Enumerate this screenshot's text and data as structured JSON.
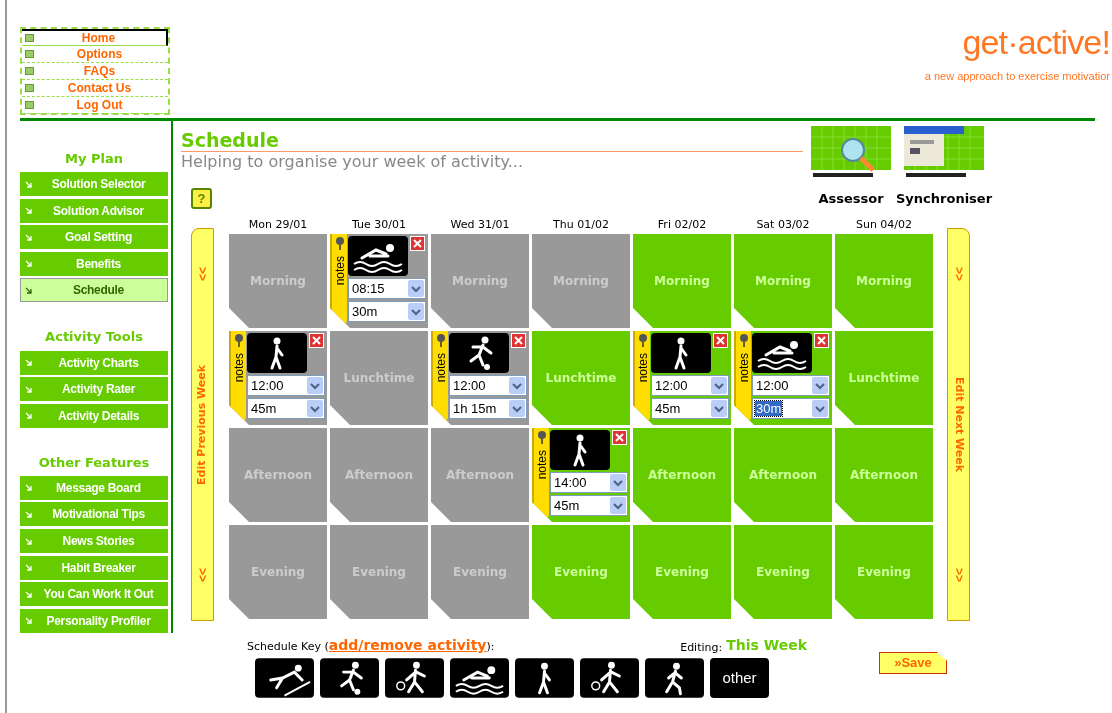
{
  "top_nav": [
    {
      "label": "Home",
      "selected": true
    },
    {
      "label": "Options",
      "selected": false
    },
    {
      "label": "FAQs",
      "selected": false
    },
    {
      "label": "Contact Us",
      "selected": false
    },
    {
      "label": "Log Out",
      "selected": false
    }
  ],
  "logo": {
    "name": "get·active!",
    "tagline": "a new approach to exercise motivatior"
  },
  "sidebar": [
    {
      "heading": "My Plan",
      "items": [
        {
          "label": "Solution Selector",
          "selected": false
        },
        {
          "label": "Solution Advisor",
          "selected": false
        },
        {
          "label": "Goal Setting",
          "selected": false
        },
        {
          "label": "Benefits",
          "selected": false
        },
        {
          "label": "Schedule",
          "selected": true
        }
      ]
    },
    {
      "heading": "Activity Tools",
      "items": [
        {
          "label": "Activity Charts",
          "selected": false
        },
        {
          "label": "Activity Rater",
          "selected": false
        },
        {
          "label": "Activity Details",
          "selected": false
        }
      ]
    },
    {
      "heading": "Other Features",
      "items": [
        {
          "label": "Message Board",
          "selected": false
        },
        {
          "label": "Motivational Tips",
          "selected": false
        },
        {
          "label": "News Stories",
          "selected": false
        },
        {
          "label": "Habit Breaker",
          "selected": false
        },
        {
          "label": "You Can Work It Out",
          "selected": false
        },
        {
          "label": "Personality Profiler",
          "selected": false
        }
      ]
    }
  ],
  "page": {
    "title": "Schedule",
    "subtitle": "Helping to organise your week of activity..."
  },
  "tools": [
    {
      "label": "Assessor",
      "kind": "picture"
    },
    {
      "label": "Synchroniser",
      "kind": "picture"
    }
  ],
  "help_button": {
    "label": "?"
  },
  "prev_week": {
    "arrows": "<<",
    "label": "Edit Previous Week"
  },
  "next_week": {
    "arrows": ">>",
    "label": "Edit Next Week"
  },
  "days": [
    "Mon 29/01",
    "Tue 30/01",
    "Wed 31/01",
    "Thu 01/02",
    "Fri 02/02",
    "Sat 03/02",
    "Sun 04/02"
  ],
  "rows": [
    {
      "cells": [
        {
          "kind": "slot",
          "label": "Morning",
          "past": true
        },
        {
          "kind": "swim",
          "past": true,
          "notes": "notes",
          "time": "08:15",
          "duration": "30m",
          "duration_focused": false
        },
        {
          "kind": "slot",
          "label": "Morning",
          "past": true
        },
        {
          "kind": "slot",
          "label": "Morning",
          "past": true
        },
        {
          "kind": "slot",
          "label": "Morning",
          "past": false
        },
        {
          "kind": "slot",
          "label": "Morning",
          "past": false
        },
        {
          "kind": "slot",
          "label": "Morning",
          "past": false
        }
      ]
    },
    {
      "cells": [
        {
          "kind": "walk",
          "past": true,
          "notes": "notes",
          "time": "12:00",
          "duration": "45m",
          "duration_focused": false
        },
        {
          "kind": "slot",
          "label": "Lunchtime",
          "past": true
        },
        {
          "kind": "kick",
          "past": true,
          "notes": "notes",
          "time": "12:00",
          "duration": "1h 15m",
          "duration_focused": false
        },
        {
          "kind": "slot",
          "label": "Lunchtime",
          "past": false
        },
        {
          "kind": "walk",
          "past": false,
          "notes": "notes",
          "time": "12:00",
          "duration": "45m",
          "duration_focused": false
        },
        {
          "kind": "swim",
          "past": false,
          "notes": "notes",
          "time": "12:00",
          "duration": "30m",
          "duration_focused": true
        },
        {
          "kind": "slot",
          "label": "Lunchtime",
          "past": false
        }
      ]
    },
    {
      "cells": [
        {
          "kind": "slot",
          "label": "Afternoon",
          "past": true
        },
        {
          "kind": "slot",
          "label": "Afternoon",
          "past": true
        },
        {
          "kind": "slot",
          "label": "Afternoon",
          "past": true
        },
        {
          "kind": "walk",
          "past": false,
          "notes": "notes",
          "time": "14:00",
          "duration": "45m",
          "duration_focused": false
        },
        {
          "kind": "slot",
          "label": "Afternoon",
          "past": false
        },
        {
          "kind": "slot",
          "label": "Afternoon",
          "past": false
        },
        {
          "kind": "slot",
          "label": "Afternoon",
          "past": false
        }
      ]
    },
    {
      "cells": [
        {
          "kind": "slot",
          "label": "Evening",
          "past": true
        },
        {
          "kind": "slot",
          "label": "Evening",
          "past": true
        },
        {
          "kind": "slot",
          "label": "Evening",
          "past": true
        },
        {
          "kind": "slot",
          "label": "Evening",
          "past": false
        },
        {
          "kind": "slot",
          "label": "Evening",
          "past": false
        },
        {
          "kind": "slot",
          "label": "Evening",
          "past": false
        },
        {
          "kind": "slot",
          "label": "Evening",
          "past": false
        }
      ]
    }
  ],
  "key": {
    "label": "Schedule Key (",
    "link": "add/remove activity",
    "label_end": "):",
    "editing_label": "Editing:",
    "editing_value": "This Week",
    "items": [
      {
        "kind": "dive"
      },
      {
        "kind": "kick"
      },
      {
        "kind": "racket"
      },
      {
        "kind": "swim"
      },
      {
        "kind": "walk"
      },
      {
        "kind": "racket"
      },
      {
        "kind": "run"
      },
      {
        "kind": "text",
        "label": "other"
      }
    ]
  },
  "save_button": {
    "label": "»Save"
  }
}
